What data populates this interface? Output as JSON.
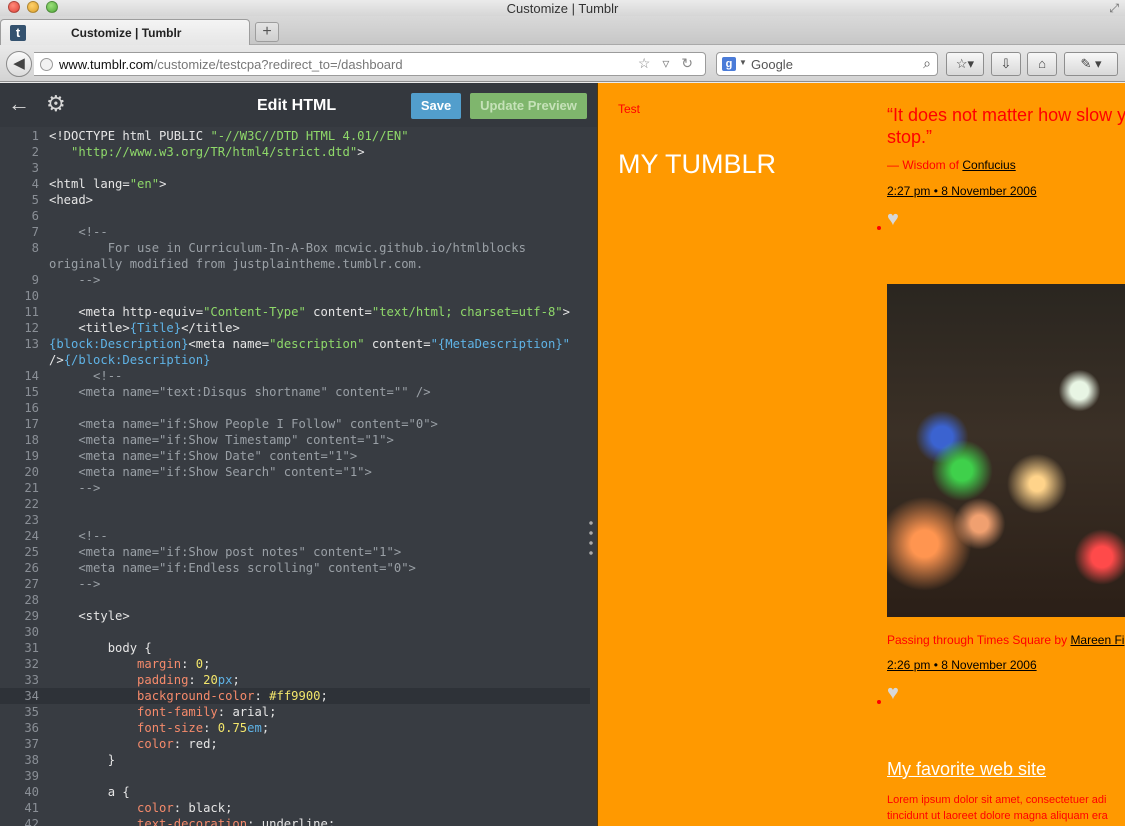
{
  "window": {
    "title": "Customize | Tumblr"
  },
  "tab": {
    "label": "Customize | Tumblr",
    "favicon": "t",
    "new_tab": "+"
  },
  "nav": {
    "back": "◀",
    "url_host": "www.tumblr.com",
    "url_rest": "/customize/testcpa?redirect_to=/dashboard",
    "search_placeholder": "Google",
    "url_icons": "☆ ▿ ↻"
  },
  "editor": {
    "back_icon": "←",
    "gear_icon": "⚙",
    "title": "Edit HTML",
    "save": "Save",
    "update_preview": "Update Preview",
    "lines": [
      {
        "n": "1",
        "segs": [
          {
            "t": "<!DOCTYPE html PUBLIC ",
            "c": "#e6e6e6"
          },
          {
            "t": "\"-//W3C//DTD HTML 4.01//EN\"",
            "c": "#8fd96a"
          }
        ]
      },
      {
        "n": "2",
        "segs": [
          {
            "t": "   \"http://www.w3.org/TR/html4/strict.dtd\"",
            "c": "#8fd96a"
          },
          {
            "t": ">",
            "c": "#e6e6e6"
          }
        ]
      },
      {
        "n": "3",
        "segs": []
      },
      {
        "n": "4",
        "segs": [
          {
            "t": "<html ",
            "c": "#e6e6e6"
          },
          {
            "t": "lang=",
            "c": "#e6e6e6"
          },
          {
            "t": "\"en\"",
            "c": "#8fd96a"
          },
          {
            "t": ">",
            "c": "#e6e6e6"
          }
        ]
      },
      {
        "n": "5",
        "segs": [
          {
            "t": "<head>",
            "c": "#e6e6e6"
          }
        ]
      },
      {
        "n": "6",
        "segs": []
      },
      {
        "n": "7",
        "segs": [
          {
            "t": "    <!--",
            "c": "#9aa0a6"
          }
        ]
      },
      {
        "n": "8",
        "segs": [
          {
            "t": "        For use in Curriculum-In-A-Box mcwic.github.io/htmlblocks",
            "c": "#9aa0a6"
          }
        ]
      },
      {
        "n": "",
        "segs": [
          {
            "t": "originally modified from justplaintheme.tumblr.com.",
            "c": "#9aa0a6"
          }
        ]
      },
      {
        "n": "9",
        "segs": [
          {
            "t": "    -->",
            "c": "#9aa0a6"
          }
        ]
      },
      {
        "n": "10",
        "segs": []
      },
      {
        "n": "11",
        "segs": [
          {
            "t": "    <meta ",
            "c": "#e6e6e6"
          },
          {
            "t": "http-equiv=",
            "c": "#e6e6e6"
          },
          {
            "t": "\"Content-Type\"",
            "c": "#8fd96a"
          },
          {
            "t": " content=",
            "c": "#e6e6e6"
          },
          {
            "t": "\"text/html; charset=utf-8\"",
            "c": "#8fd96a"
          },
          {
            "t": ">",
            "c": "#e6e6e6"
          }
        ]
      },
      {
        "n": "12",
        "segs": [
          {
            "t": "    <title>",
            "c": "#e6e6e6"
          },
          {
            "t": "{Title}",
            "c": "#5fb3e6"
          },
          {
            "t": "</title>",
            "c": "#e6e6e6"
          }
        ]
      },
      {
        "n": "13",
        "segs": [
          {
            "t": "{block:Description}",
            "c": "#5fb3e6"
          },
          {
            "t": "<meta ",
            "c": "#e6e6e6"
          },
          {
            "t": "name=",
            "c": "#e6e6e6"
          },
          {
            "t": "\"description\"",
            "c": "#8fd96a"
          },
          {
            "t": " content=",
            "c": "#e6e6e6"
          },
          {
            "t": "\"{MetaDescription}\"",
            "c": "#5fb3e6"
          }
        ]
      },
      {
        "n": "",
        "segs": [
          {
            "t": "/>",
            "c": "#e6e6e6"
          },
          {
            "t": "{/block:Description}",
            "c": "#5fb3e6"
          }
        ]
      },
      {
        "n": "14",
        "segs": [
          {
            "t": "      <!--",
            "c": "#9aa0a6"
          }
        ]
      },
      {
        "n": "15",
        "segs": [
          {
            "t": "    <meta name=\"text:Disqus shortname\" content=\"\" />",
            "c": "#9aa0a6"
          }
        ]
      },
      {
        "n": "16",
        "segs": []
      },
      {
        "n": "17",
        "segs": [
          {
            "t": "    <meta name=\"if:Show People I Follow\" content=\"0\">",
            "c": "#9aa0a6"
          }
        ]
      },
      {
        "n": "18",
        "segs": [
          {
            "t": "    <meta name=\"if:Show Timestamp\" content=\"1\">",
            "c": "#9aa0a6"
          }
        ]
      },
      {
        "n": "19",
        "segs": [
          {
            "t": "    <meta name=\"if:Show Date\" content=\"1\">",
            "c": "#9aa0a6"
          }
        ]
      },
      {
        "n": "20",
        "segs": [
          {
            "t": "    <meta name=\"if:Show Search\" content=\"1\">",
            "c": "#9aa0a6"
          }
        ]
      },
      {
        "n": "21",
        "segs": [
          {
            "t": "    -->",
            "c": "#9aa0a6"
          }
        ]
      },
      {
        "n": "22",
        "segs": []
      },
      {
        "n": "23",
        "segs": []
      },
      {
        "n": "24",
        "segs": [
          {
            "t": "    <!--",
            "c": "#9aa0a6"
          }
        ]
      },
      {
        "n": "25",
        "segs": [
          {
            "t": "    <meta name=\"if:Show post notes\" content=\"1\">",
            "c": "#9aa0a6"
          }
        ]
      },
      {
        "n": "26",
        "segs": [
          {
            "t": "    <meta name=\"if:Endless scrolling\" content=\"0\">",
            "c": "#9aa0a6"
          }
        ]
      },
      {
        "n": "27",
        "segs": [
          {
            "t": "    -->",
            "c": "#9aa0a6"
          }
        ]
      },
      {
        "n": "28",
        "segs": []
      },
      {
        "n": "29",
        "segs": [
          {
            "t": "    <style>",
            "c": "#e6e6e6"
          }
        ]
      },
      {
        "n": "30",
        "segs": []
      },
      {
        "n": "31",
        "segs": [
          {
            "t": "        body {",
            "c": "#e6e6e6"
          }
        ]
      },
      {
        "n": "32",
        "segs": [
          {
            "t": "            margin",
            "c": "#f58a6b"
          },
          {
            "t": ": ",
            "c": "#e6e6e6"
          },
          {
            "t": "0",
            "c": "#f2e56b"
          },
          {
            "t": ";",
            "c": "#e6e6e6"
          }
        ]
      },
      {
        "n": "33",
        "segs": [
          {
            "t": "            padding",
            "c": "#f58a6b"
          },
          {
            "t": ": ",
            "c": "#e6e6e6"
          },
          {
            "t": "20",
            "c": "#f2e56b"
          },
          {
            "t": "px",
            "c": "#5fb3e6"
          },
          {
            "t": ";",
            "c": "#e6e6e6"
          }
        ]
      },
      {
        "n": "34",
        "hl": true,
        "segs": [
          {
            "t": "            background-color",
            "c": "#f58a6b"
          },
          {
            "t": ": ",
            "c": "#e6e6e6"
          },
          {
            "t": "#ff9900",
            "c": "#f2e56b"
          },
          {
            "t": ";",
            "c": "#e6e6e6"
          }
        ]
      },
      {
        "n": "35",
        "segs": [
          {
            "t": "            font-family",
            "c": "#f58a6b"
          },
          {
            "t": ": arial;",
            "c": "#e6e6e6"
          }
        ]
      },
      {
        "n": "36",
        "segs": [
          {
            "t": "            font-size",
            "c": "#f58a6b"
          },
          {
            "t": ": ",
            "c": "#e6e6e6"
          },
          {
            "t": "0.75",
            "c": "#f2e56b"
          },
          {
            "t": "em",
            "c": "#5fb3e6"
          },
          {
            "t": ";",
            "c": "#e6e6e6"
          }
        ]
      },
      {
        "n": "37",
        "segs": [
          {
            "t": "            color",
            "c": "#f58a6b"
          },
          {
            "t": ": red;",
            "c": "#e6e6e6"
          }
        ]
      },
      {
        "n": "38",
        "segs": [
          {
            "t": "        }",
            "c": "#e6e6e6"
          }
        ]
      },
      {
        "n": "39",
        "segs": []
      },
      {
        "n": "40",
        "segs": [
          {
            "t": "        a {",
            "c": "#e6e6e6"
          }
        ]
      },
      {
        "n": "41",
        "segs": [
          {
            "t": "            color",
            "c": "#f58a6b"
          },
          {
            "t": ": black;",
            "c": "#e6e6e6"
          }
        ]
      },
      {
        "n": "42",
        "segs": [
          {
            "t": "            text-decoration",
            "c": "#f58a6b"
          },
          {
            "t": ": underline;",
            "c": "#e6e6e6"
          }
        ]
      }
    ]
  },
  "preview": {
    "test": "Test",
    "title": "MY TUMBLR",
    "quote": "“It does not matter how slow y stop.”",
    "source_prefix": "— Wisdom of ",
    "source_link": "Confucius",
    "stamp1": "2:27 pm  •  8 November 2006",
    "caption_prefix": "Passing through Times Square by ",
    "caption_link": "Mareen Fi",
    "stamp2": "2:26 pm  •  8 November 2006",
    "link_title": "My favorite web site",
    "body_line1": "Lorem ipsum dolor sit amet, consectetuer adi",
    "body_line2": "tincidunt ut laoreet dolore magna aliquam era"
  },
  "colors": {
    "preview_bg": "#ff9900",
    "editor_bg": "#383c42",
    "save_btn": "#529ecc",
    "preview_btn": "#7fb66d"
  }
}
